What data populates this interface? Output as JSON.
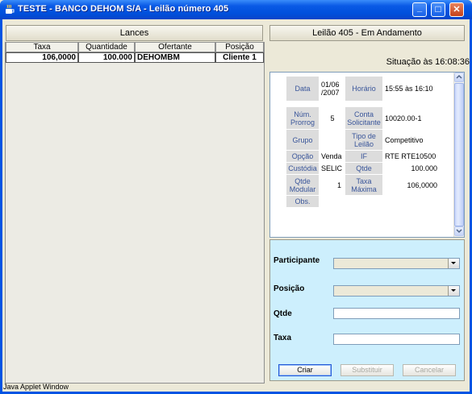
{
  "window": {
    "title": "TESTE - BANCO DEHOM S/A - Leilão número 405",
    "minimize_glyph": "_",
    "maximize_glyph": "□",
    "close_glyph": "✕"
  },
  "left": {
    "header": "Lances",
    "columns": [
      "Taxa",
      "Quantidade",
      "Ofertante",
      "Posição"
    ],
    "rows": [
      {
        "taxa": "106,0000",
        "quantidade": "100.000",
        "ofertante": "DEHOMBM",
        "posicao": "Cliente 1"
      }
    ]
  },
  "right": {
    "header": "Leilão 405 - Em Andamento",
    "status": "Situação às 16:08:36",
    "info": {
      "data_label": "Data",
      "data_value_line1": "01/06",
      "data_value_line2": "/2007",
      "horario_label": "Horário",
      "horario_value": "15:55 às 16:10",
      "num_prorrog_label": "Núm. Prorrog",
      "num_prorrog_value": "5",
      "conta_label": "Conta Solicitante",
      "conta_value": "10020.00-1",
      "grupo_label": "Grupo",
      "grupo_value": "",
      "tipo_label": "Tipo de Leilão",
      "tipo_value": "Competitivo",
      "opcao_label": "Opção",
      "opcao_value": "Venda",
      "if_label": "IF",
      "if_value": "RTE RTE10500",
      "custodia_label": "Custódia",
      "custodia_value": "SELIC",
      "qtde_label": "Qtde",
      "qtde_value": "100.000",
      "qtde_modular_label": "Qtde Modular",
      "qtde_modular_value": "1",
      "taxa_maxima_label": "Taxa Máxima",
      "taxa_maxima_value": "106,0000",
      "obs_label": "Obs.",
      "obs_value": ""
    },
    "form": {
      "participante_label": "Participante",
      "participante_value": "",
      "posicao_label": "Posição",
      "posicao_value": "",
      "qtde_label": "Qtde",
      "qtde_value": "",
      "taxa_label": "Taxa",
      "taxa_value": "",
      "criar_label": "Criar",
      "substituir_label": "Substituir",
      "cancelar_label": "Cancelar"
    }
  },
  "statusbar": "Java Applet Window",
  "colors": {
    "titlebar": "#0054e3",
    "form_bg": "#cdeffd",
    "label_bg": "#dcdcdc",
    "label_text": "#39559a"
  }
}
